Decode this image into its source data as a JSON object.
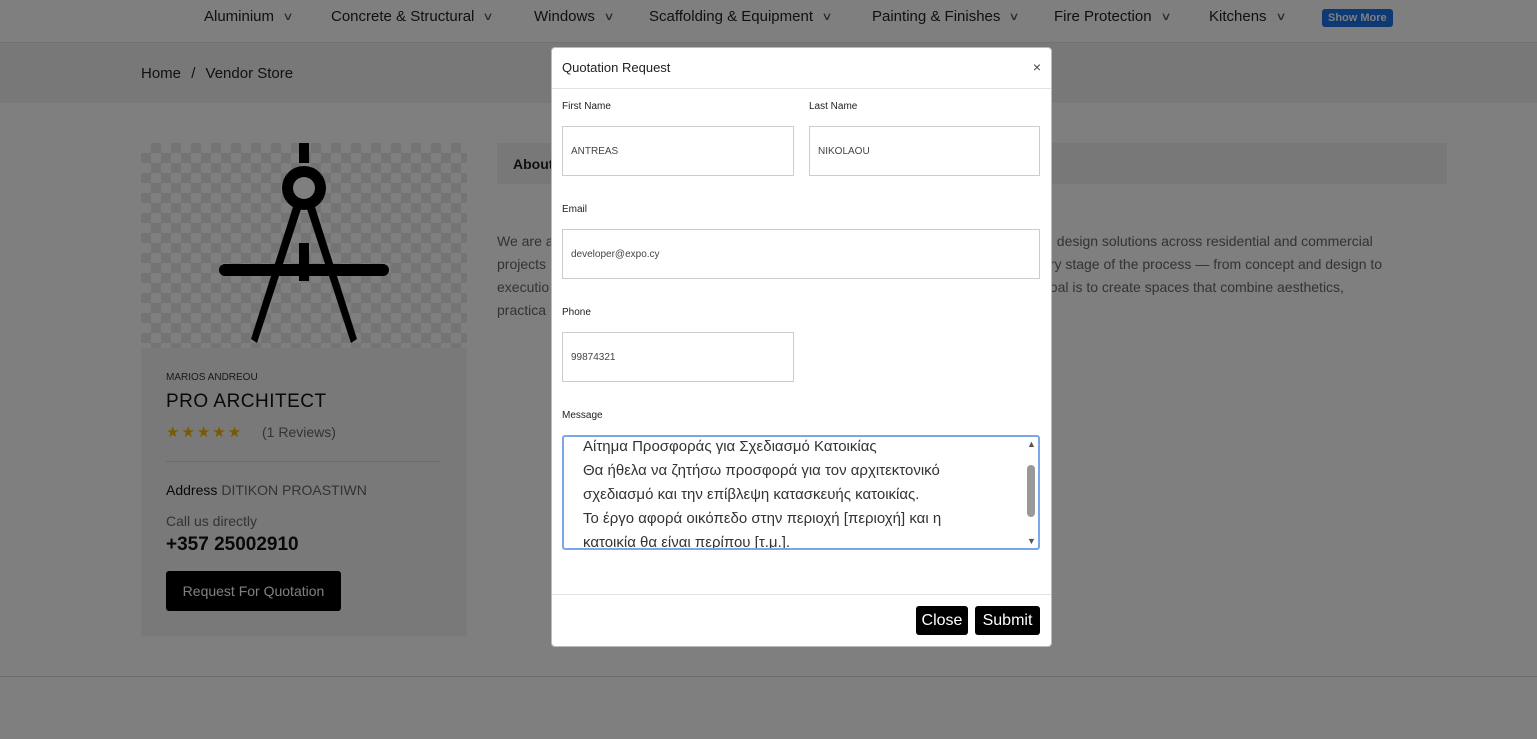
{
  "nav": {
    "items": [
      {
        "label": "Aluminium"
      },
      {
        "label": "Concrete & Structural"
      },
      {
        "label": "Windows"
      },
      {
        "label": "Scaffolding & Equipment"
      },
      {
        "label": "Painting & Finishes"
      },
      {
        "label": "Fire Protection"
      },
      {
        "label": "Kitchens"
      }
    ],
    "show_more": "Show More"
  },
  "breadcrumb": {
    "home": "Home",
    "separator": "/",
    "current": "Vendor Store"
  },
  "vendor": {
    "owner": "MARIOS ANDREOU",
    "store_name": "PRO ARCHITECT",
    "stars": "★★★★★",
    "reviews": "(1 Reviews)",
    "address_label": "Address",
    "address_value": "DITIKON PROASTIWN",
    "call_label": "Call us directly",
    "phone": "+357 25002910",
    "rfq_button": "Request For Quotation"
  },
  "about": {
    "tab_label": "About",
    "lines": [
      "We are a",
      "projects",
      "executio",
      "practica"
    ],
    "right_lines": [
      "al design solutions across residential and commercial",
      "ery stage of the process — from concept and design to",
      "goal is to create spaces that combine aesthetics,"
    ]
  },
  "modal": {
    "title": "Quotation Request",
    "close_x": "×",
    "first_name_label": "First Name",
    "first_name_value": "ANTREAS",
    "last_name_label": "Last Name",
    "last_name_value": "NIKOLAOU",
    "email_label": "Email",
    "email_value": "developer@expo.cy",
    "phone_label": "Phone",
    "phone_value": "99874321",
    "message_label": "Message",
    "message_lines": [
      "Αίτημα Προσφοράς για Σχεδιασμό Κατοικίας",
      "Θα ήθελα να ζητήσω προσφορά για τον αρχιτεκτονικό",
      "σχεδιασμό και την επίβλεψη κατασκευής κατοικίας.",
      "Το έργο αφορά οικόπεδο στην περιοχή [περιοχή] και η",
      "κατοικία θα είναι περίπου [τ.μ.]."
    ],
    "close_button": "Close",
    "submit_button": "Submit"
  },
  "colors": {
    "accent": "#1a73e8",
    "button": "#000000",
    "star": "#f0b400"
  },
  "icons": {
    "nav_chevron": "chevron-down-icon",
    "logo": "compass-architect-logo"
  }
}
